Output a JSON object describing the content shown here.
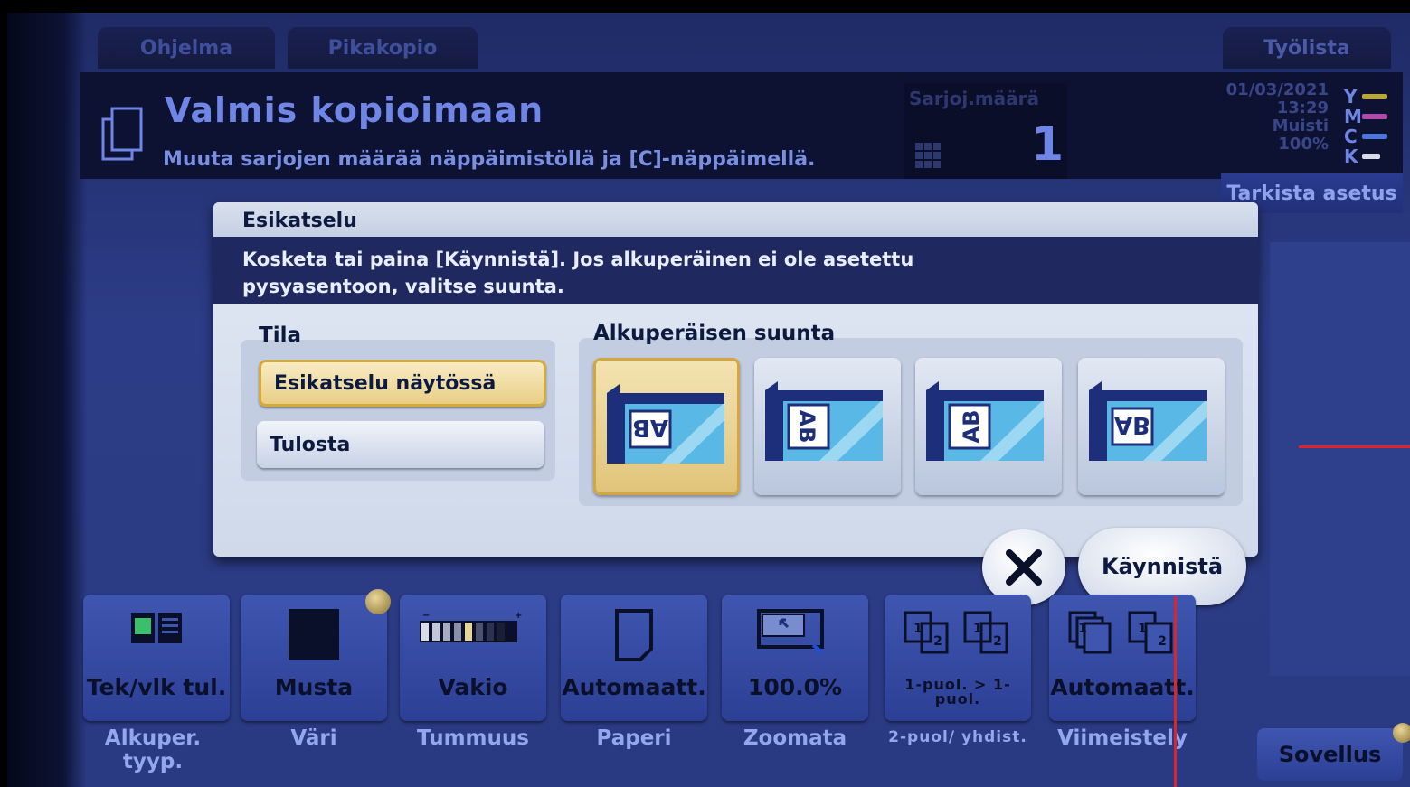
{
  "tabs": [
    {
      "label": "Ohjelma"
    },
    {
      "label": "Pikakopio"
    },
    {
      "label": "Työlista"
    }
  ],
  "header": {
    "title": "Valmis kopioimaan",
    "subtitle": "Muuta sarjojen määrää näppäimistöllä ja [C]-näppäimellä."
  },
  "sets": {
    "label": "Sarjoj.määrä",
    "value": "1"
  },
  "status": {
    "date": "01/03/2021",
    "time": "13:29",
    "memory_label": "Muisti",
    "memory_value": "100%"
  },
  "toner": [
    {
      "letter": "Y",
      "color": "#b8a83a"
    },
    {
      "letter": "M",
      "color": "#b04aa8"
    },
    {
      "letter": "C",
      "color": "#4a78d8"
    },
    {
      "letter": "K",
      "color": "#d8dce8"
    }
  ],
  "check_button": {
    "label": "Tarkista asetus"
  },
  "dialog": {
    "title": "Esikatselu",
    "message": "Kosketa tai paina [Käynnistä]. Jos alkuperäinen ei ole asetettu pysyasentoon, valitse suunta.",
    "mode": {
      "label": "Tila",
      "options": [
        "Esikatselu näytössä",
        "Tulosta"
      ],
      "selected": 0
    },
    "orientation": {
      "label": "Alkuperäisen suunta",
      "options": [
        {
          "glyph": "AB",
          "name": "orientation-up-icon"
        },
        {
          "glyph": "AB",
          "name": "orientation-left-icon"
        },
        {
          "glyph": "AB",
          "name": "orientation-right-icon"
        },
        {
          "glyph": "AB",
          "name": "orientation-down-icon"
        }
      ],
      "selected": 0
    }
  },
  "actions": {
    "start": "Käynnistä"
  },
  "tiles": [
    {
      "value": "Tek/vlk tul.",
      "caption": "Alkuper. tyyp."
    },
    {
      "value": "Musta",
      "caption": "Väri"
    },
    {
      "value": "Vakio",
      "caption": "Tummuus"
    },
    {
      "value": "Automaatt.",
      "caption": "Paperi"
    },
    {
      "value": "100.0%",
      "caption": "Zoomata"
    },
    {
      "value": "1-puol. > 1-puol.",
      "caption": "2-puol/ yhdist."
    },
    {
      "value": "Automaatt.",
      "caption": "Viimeistely"
    }
  ],
  "app_button": {
    "label": "Sovellus"
  }
}
